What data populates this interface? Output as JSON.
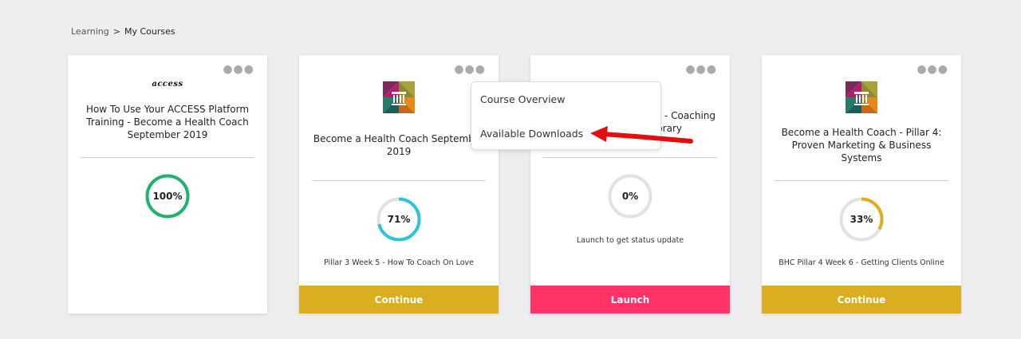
{
  "breadcrumb": {
    "learning": "Learning",
    "separator": ">",
    "current": "My Courses"
  },
  "cards": [
    {
      "logo_text": "access",
      "title": "How To Use Your ACCESS Platform Training - Become a Health Coach September 2019",
      "progress_label": "100%",
      "progress": 1.0,
      "ring_color": "#1db36d",
      "status": "",
      "button": ""
    },
    {
      "title": "Become a Health Coach September 2019",
      "progress_label": "71%",
      "progress": 0.71,
      "ring_color": "#2bc4d8",
      "status": "Pillar 3 Week 5 - How To Coach On Love",
      "button": "Continue",
      "button_color": "#dbae22"
    },
    {
      "title_line1_visible": "- Coaching",
      "title_line2_visible": "ibrary",
      "progress_label": "0%",
      "progress": 0,
      "ring_color": "#e2e2e2",
      "status": "Launch to get status update",
      "button": "Launch",
      "button_color": "#ff3366"
    },
    {
      "title": "Become a Health Coach - Pillar 4: Proven Marketing & Business Systems",
      "progress_label": "33%",
      "progress": 0.33,
      "ring_color": "#dbae22",
      "status": "BHC Pillar 4 Week 6 - Getting Clients Online",
      "button": "Continue",
      "button_color": "#dbae22"
    }
  ],
  "menu": {
    "items": [
      "Course Overview",
      "Available Downloads"
    ]
  },
  "colors": {
    "background": "#eeeef0",
    "track": "#e2e2e2",
    "annotation_arrow": "#e01010"
  },
  "icons": {
    "more": "more-options-icon",
    "course_logo": "pillar-logo-icon"
  }
}
